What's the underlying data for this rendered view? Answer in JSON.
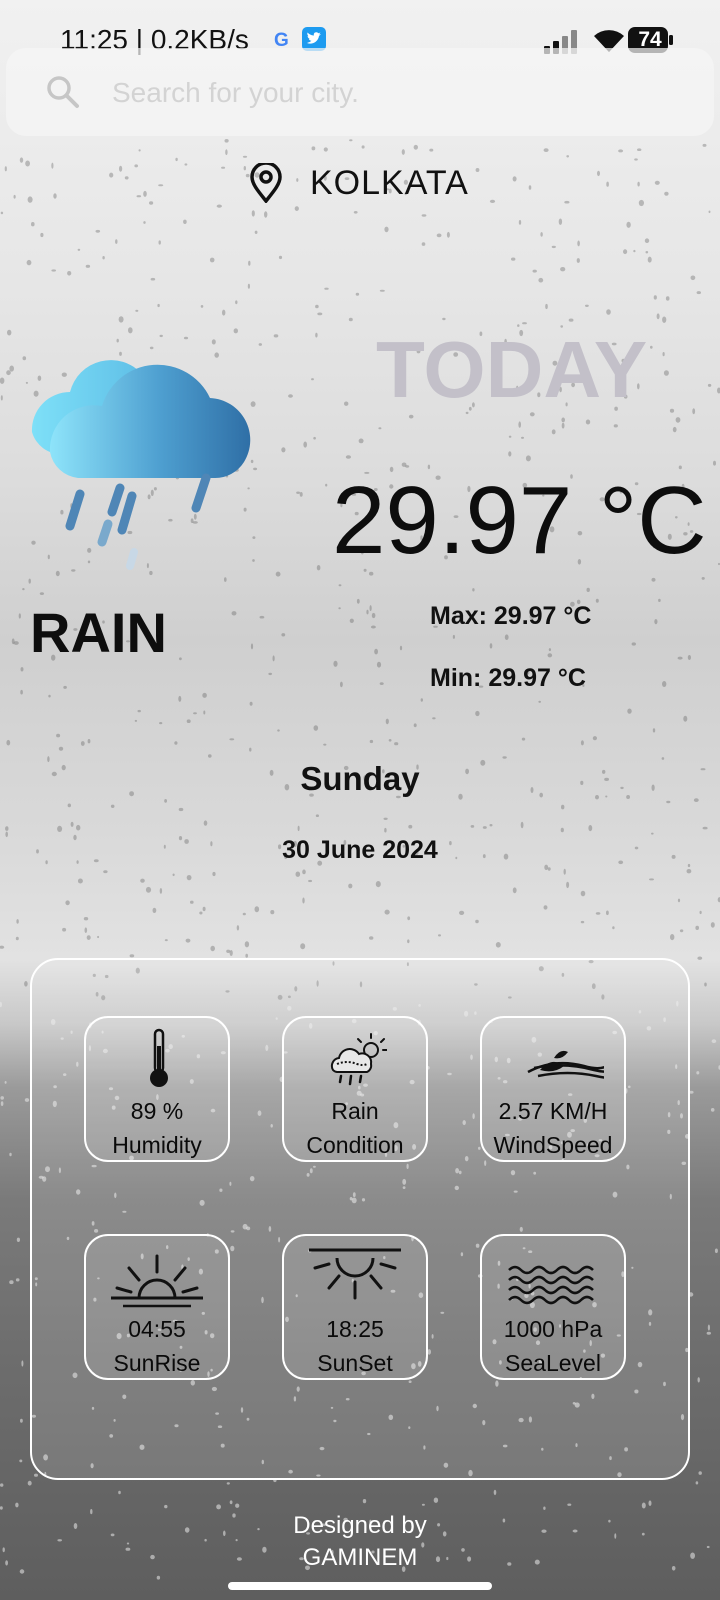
{
  "status_bar": {
    "time_speed": "11:25 | 0.2KB/s",
    "battery": "74",
    "icons": [
      "google-icon",
      "twitter-icon",
      "signal-icon",
      "wifi-icon",
      "battery-icon"
    ]
  },
  "search": {
    "placeholder": "Search for your city.",
    "value": ""
  },
  "location": {
    "city": "KOLKATA"
  },
  "weather": {
    "icon": "rain-cloud-icon",
    "condition_title": "RAIN",
    "today_label": "TODAY",
    "temperature": "29.97 °C",
    "max": "Max: 29.97 °C",
    "min": "Min: 29.97 °C",
    "day": "Sunday",
    "date": "30 June 2024"
  },
  "details": [
    {
      "icon": "thermometer-icon",
      "value": "89 %",
      "label": "Humidity"
    },
    {
      "icon": "rain-cloud-sun-icon",
      "value": "Rain",
      "label": "Condition"
    },
    {
      "icon": "wind-icon",
      "value": "2.57 KM/H",
      "label": "WindSpeed"
    },
    {
      "icon": "sunrise-icon",
      "value": "04:55",
      "label": "SunRise"
    },
    {
      "icon": "sunset-icon",
      "value": "18:25",
      "label": "SunSet"
    },
    {
      "icon": "sea-waves-icon",
      "value": "1000 hPa",
      "label": "SeaLevel"
    }
  ],
  "footer": {
    "line1": "Designed by",
    "line2": "GAMINEM"
  },
  "colors": {
    "today_label": "#c3c0c9",
    "cloud_light": "#8ee4fa",
    "cloud_dark": "#2f6fa6",
    "twitter": "#1d9bf0"
  }
}
